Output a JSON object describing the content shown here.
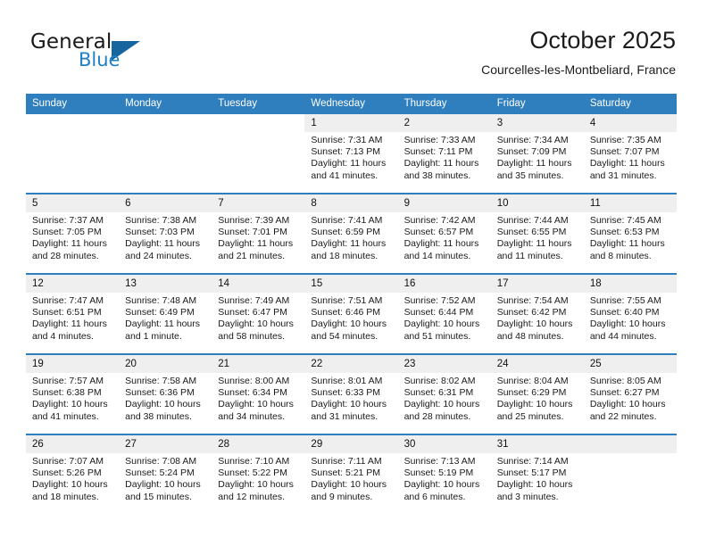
{
  "brand": {
    "name_part1": "General",
    "name_part2": "Blue",
    "accent_color": "#1f7fc4",
    "triangle_color": "#16659f"
  },
  "header": {
    "title": "October 2025",
    "subtitle": "Courcelles-les-Montbeliard, France"
  },
  "theme": {
    "header_blue": "#2f7ebd",
    "daynum_band": "#efefef",
    "text": "#1a1a1a"
  },
  "labels": {
    "sunrise": "Sunrise:",
    "sunset": "Sunset:",
    "daylight": "Daylight:"
  },
  "weekdays": [
    "Sunday",
    "Monday",
    "Tuesday",
    "Wednesday",
    "Thursday",
    "Friday",
    "Saturday"
  ],
  "weeks": [
    [
      {
        "day": "",
        "blank": true
      },
      {
        "day": "",
        "blank": true
      },
      {
        "day": "",
        "blank": true
      },
      {
        "day": "1",
        "sunrise": "Sunrise: 7:31 AM",
        "sunset": "Sunset: 7:13 PM",
        "daylight": "Daylight: 11 hours and 41 minutes."
      },
      {
        "day": "2",
        "sunrise": "Sunrise: 7:33 AM",
        "sunset": "Sunset: 7:11 PM",
        "daylight": "Daylight: 11 hours and 38 minutes."
      },
      {
        "day": "3",
        "sunrise": "Sunrise: 7:34 AM",
        "sunset": "Sunset: 7:09 PM",
        "daylight": "Daylight: 11 hours and 35 minutes."
      },
      {
        "day": "4",
        "sunrise": "Sunrise: 7:35 AM",
        "sunset": "Sunset: 7:07 PM",
        "daylight": "Daylight: 11 hours and 31 minutes."
      }
    ],
    [
      {
        "day": "5",
        "sunrise": "Sunrise: 7:37 AM",
        "sunset": "Sunset: 7:05 PM",
        "daylight": "Daylight: 11 hours and 28 minutes."
      },
      {
        "day": "6",
        "sunrise": "Sunrise: 7:38 AM",
        "sunset": "Sunset: 7:03 PM",
        "daylight": "Daylight: 11 hours and 24 minutes."
      },
      {
        "day": "7",
        "sunrise": "Sunrise: 7:39 AM",
        "sunset": "Sunset: 7:01 PM",
        "daylight": "Daylight: 11 hours and 21 minutes."
      },
      {
        "day": "8",
        "sunrise": "Sunrise: 7:41 AM",
        "sunset": "Sunset: 6:59 PM",
        "daylight": "Daylight: 11 hours and 18 minutes."
      },
      {
        "day": "9",
        "sunrise": "Sunrise: 7:42 AM",
        "sunset": "Sunset: 6:57 PM",
        "daylight": "Daylight: 11 hours and 14 minutes."
      },
      {
        "day": "10",
        "sunrise": "Sunrise: 7:44 AM",
        "sunset": "Sunset: 6:55 PM",
        "daylight": "Daylight: 11 hours and 11 minutes."
      },
      {
        "day": "11",
        "sunrise": "Sunrise: 7:45 AM",
        "sunset": "Sunset: 6:53 PM",
        "daylight": "Daylight: 11 hours and 8 minutes."
      }
    ],
    [
      {
        "day": "12",
        "sunrise": "Sunrise: 7:47 AM",
        "sunset": "Sunset: 6:51 PM",
        "daylight": "Daylight: 11 hours and 4 minutes."
      },
      {
        "day": "13",
        "sunrise": "Sunrise: 7:48 AM",
        "sunset": "Sunset: 6:49 PM",
        "daylight": "Daylight: 11 hours and 1 minute."
      },
      {
        "day": "14",
        "sunrise": "Sunrise: 7:49 AM",
        "sunset": "Sunset: 6:47 PM",
        "daylight": "Daylight: 10 hours and 58 minutes."
      },
      {
        "day": "15",
        "sunrise": "Sunrise: 7:51 AM",
        "sunset": "Sunset: 6:46 PM",
        "daylight": "Daylight: 10 hours and 54 minutes."
      },
      {
        "day": "16",
        "sunrise": "Sunrise: 7:52 AM",
        "sunset": "Sunset: 6:44 PM",
        "daylight": "Daylight: 10 hours and 51 minutes."
      },
      {
        "day": "17",
        "sunrise": "Sunrise: 7:54 AM",
        "sunset": "Sunset: 6:42 PM",
        "daylight": "Daylight: 10 hours and 48 minutes."
      },
      {
        "day": "18",
        "sunrise": "Sunrise: 7:55 AM",
        "sunset": "Sunset: 6:40 PM",
        "daylight": "Daylight: 10 hours and 44 minutes."
      }
    ],
    [
      {
        "day": "19",
        "sunrise": "Sunrise: 7:57 AM",
        "sunset": "Sunset: 6:38 PM",
        "daylight": "Daylight: 10 hours and 41 minutes."
      },
      {
        "day": "20",
        "sunrise": "Sunrise: 7:58 AM",
        "sunset": "Sunset: 6:36 PM",
        "daylight": "Daylight: 10 hours and 38 minutes."
      },
      {
        "day": "21",
        "sunrise": "Sunrise: 8:00 AM",
        "sunset": "Sunset: 6:34 PM",
        "daylight": "Daylight: 10 hours and 34 minutes."
      },
      {
        "day": "22",
        "sunrise": "Sunrise: 8:01 AM",
        "sunset": "Sunset: 6:33 PM",
        "daylight": "Daylight: 10 hours and 31 minutes."
      },
      {
        "day": "23",
        "sunrise": "Sunrise: 8:02 AM",
        "sunset": "Sunset: 6:31 PM",
        "daylight": "Daylight: 10 hours and 28 minutes."
      },
      {
        "day": "24",
        "sunrise": "Sunrise: 8:04 AM",
        "sunset": "Sunset: 6:29 PM",
        "daylight": "Daylight: 10 hours and 25 minutes."
      },
      {
        "day": "25",
        "sunrise": "Sunrise: 8:05 AM",
        "sunset": "Sunset: 6:27 PM",
        "daylight": "Daylight: 10 hours and 22 minutes."
      }
    ],
    [
      {
        "day": "26",
        "sunrise": "Sunrise: 7:07 AM",
        "sunset": "Sunset: 5:26 PM",
        "daylight": "Daylight: 10 hours and 18 minutes."
      },
      {
        "day": "27",
        "sunrise": "Sunrise: 7:08 AM",
        "sunset": "Sunset: 5:24 PM",
        "daylight": "Daylight: 10 hours and 15 minutes."
      },
      {
        "day": "28",
        "sunrise": "Sunrise: 7:10 AM",
        "sunset": "Sunset: 5:22 PM",
        "daylight": "Daylight: 10 hours and 12 minutes."
      },
      {
        "day": "29",
        "sunrise": "Sunrise: 7:11 AM",
        "sunset": "Sunset: 5:21 PM",
        "daylight": "Daylight: 10 hours and 9 minutes."
      },
      {
        "day": "30",
        "sunrise": "Sunrise: 7:13 AM",
        "sunset": "Sunset: 5:19 PM",
        "daylight": "Daylight: 10 hours and 6 minutes."
      },
      {
        "day": "31",
        "sunrise": "Sunrise: 7:14 AM",
        "sunset": "Sunset: 5:17 PM",
        "daylight": "Daylight: 10 hours and 3 minutes."
      },
      {
        "day": "",
        "empty": true
      }
    ]
  ]
}
